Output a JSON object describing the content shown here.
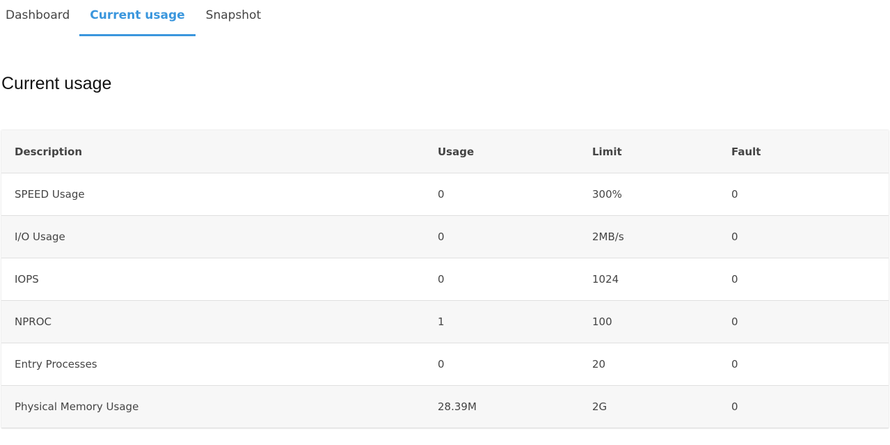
{
  "tabs": [
    {
      "label": "Dashboard",
      "active": false
    },
    {
      "label": "Current usage",
      "active": true
    },
    {
      "label": "Snapshot",
      "active": false
    }
  ],
  "page_title": "Current usage",
  "table": {
    "headers": [
      "Description",
      "Usage",
      "Limit",
      "Fault"
    ],
    "rows": [
      [
        "SPEED Usage",
        "0",
        "300%",
        "0"
      ],
      [
        "I/O Usage",
        "0",
        "2MB/s",
        "0"
      ],
      [
        "IOPS",
        "0",
        "1024",
        "0"
      ],
      [
        "NPROC",
        "1",
        "100",
        "0"
      ],
      [
        "Entry Processes",
        "0",
        "20",
        "0"
      ],
      [
        "Physical Memory Usage",
        "28.39M",
        "2G",
        "0"
      ]
    ]
  },
  "colors": {
    "accent": "#3a96dd",
    "header_bg": "#f7f7f7",
    "row_alt_bg": "#f7f7f7",
    "border": "#e0e0e0"
  }
}
